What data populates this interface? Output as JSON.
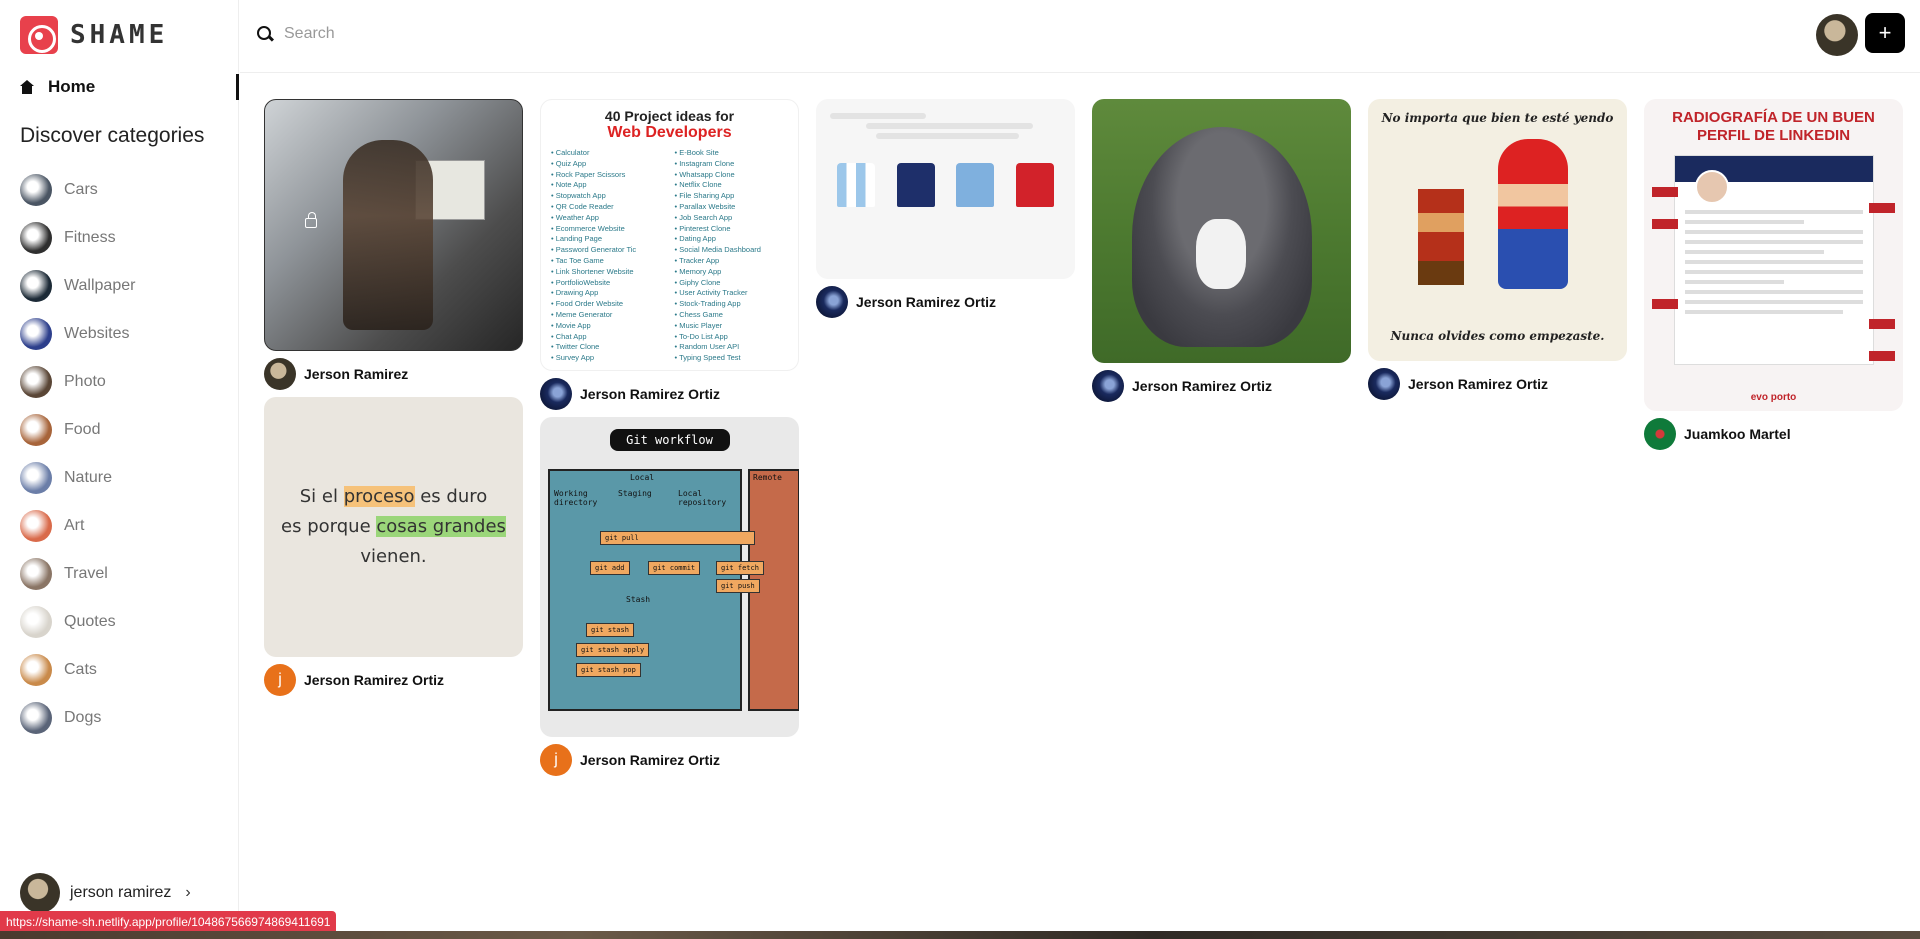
{
  "app": {
    "name": "SHAME"
  },
  "sidebar": {
    "home_label": "Home",
    "discover_title": "Discover categories",
    "categories": [
      {
        "label": "Cars",
        "color": "#4a5563"
      },
      {
        "label": "Fitness",
        "color": "#2f2f2f"
      },
      {
        "label": "Wallpaper",
        "color": "#1c2a36"
      },
      {
        "label": "Websites",
        "color": "#2d3f8c"
      },
      {
        "label": "Photo",
        "color": "#5a4636"
      },
      {
        "label": "Food",
        "color": "#a7643a"
      },
      {
        "label": "Nature",
        "color": "#6b7ea8"
      },
      {
        "label": "Art",
        "color": "#d96a4a"
      },
      {
        "label": "Travel",
        "color": "#8a7565"
      },
      {
        "label": "Quotes",
        "color": "#d8d4cc"
      },
      {
        "label": "Cats",
        "color": "#c98a4a"
      },
      {
        "label": "Dogs",
        "color": "#5a6478"
      }
    ],
    "profile_name": "jerson ramirez"
  },
  "search": {
    "placeholder": "Search"
  },
  "header": {
    "add_label": "+"
  },
  "status_link": "https://shame-sh.netlify.app/profile/104867566974869411691",
  "pins": {
    "p1_author": "Jerson Ramirez",
    "p2_author": "Jerson Ramirez Ortiz",
    "p3_author": "Jerson Ramirez Ortiz",
    "p4_author": "Jerson Ramirez Ortiz",
    "p5_author": "Jerson Ramirez Ortiz",
    "p6_author": "Jerson Ramirez Ortiz",
    "p7_author": "Jerson Ramirez Ortiz",
    "p8_author": "Juamkoo Martel",
    "letter_avatar": "j",
    "quote_part1": "Si el ",
    "quote_hl1": "proceso",
    "quote_part2": " es duro",
    "quote_part3": "es porque ",
    "quote_hl2": "cosas grandes",
    "quote_part4": "vienen.",
    "list_title": "40 Project ideas for",
    "list_subtitle": "Web Developers",
    "list_col1": [
      "Calculator",
      "Quiz App",
      "Rock Paper Scissors",
      "Note App",
      "Stopwatch App",
      "QR Code Reader",
      "Weather App",
      "Ecommerce Website",
      "Landing Page",
      "Password Generator Tic",
      "Tac Toe Game",
      "Link Shortener Website",
      "PortfolioWebsite",
      "Drawing App",
      "Food Order Website",
      "Meme Generator",
      "Movie App",
      "Chat App",
      "Twitter Clone",
      "Survey App"
    ],
    "list_col2": [
      "E-Book Site",
      "Instagram Clone",
      "Whatsapp Clone",
      "Netflix Clone",
      "File Sharing App",
      "Parallax Website",
      "Job Search App",
      "Pinterest Clone",
      "Dating App",
      "Social Media Dashboard",
      "Tracker App",
      "Memory App",
      "Giphy Clone",
      "User Activity Tracker",
      "Stock-Trading App",
      "Chess Game",
      "Music Player",
      "To-Do List App",
      "Random User API",
      "Typing Speed Test"
    ],
    "git_title": "Git workflow",
    "git_local": "Local",
    "git_remote": "Remote",
    "git_working": "Working directory",
    "git_staging": "Staging",
    "git_repo": "Local repository",
    "git_stash_label": "Stash",
    "git_pull": "git pull",
    "git_add": "git add",
    "git_commit": "git commit",
    "git_fetch": "git fetch",
    "git_push": "git push",
    "git_stash": "git stash",
    "git_stash_apply": "git stash apply",
    "git_stash_pop": "git stash pop",
    "mario_top": "No importa que bien te esté yendo",
    "mario_bottom": "Nunca olvides como empezaste.",
    "linkedin_title": "RADIOGRAFÍA DE UN BUEN PERFIL DE LINKEDIN",
    "linkedin_brand": "evo porto"
  },
  "colors": {
    "accent": "#e8414c",
    "status_bar": "#e13a4a"
  }
}
